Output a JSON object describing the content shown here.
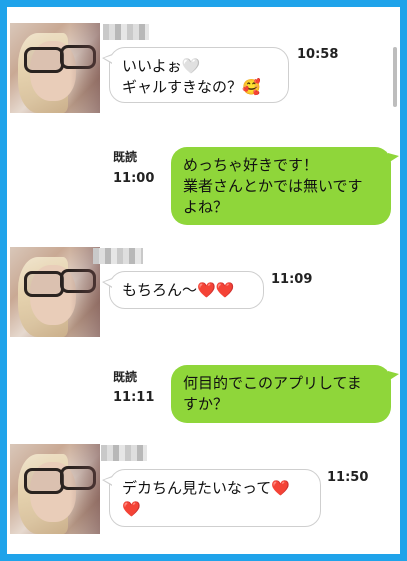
{
  "messages": [
    {
      "side": "in",
      "text": "いいよぉ🤍\nギャルすきなの？🥰",
      "time": "10:58"
    },
    {
      "side": "out",
      "read": "既読",
      "time": "11:00",
      "text": "めっちゃ好きです！\n業者さんとかでは無いです\nよね？"
    },
    {
      "side": "in",
      "text": "もちろん〜❤️❤️",
      "time": "11:09"
    },
    {
      "side": "out",
      "read": "既読",
      "time": "11:11",
      "text": "何目的でこのアプリしてま\nすか？"
    },
    {
      "side": "in",
      "text": "デカちん見たいなって❤️\n❤️",
      "time": "11:50"
    }
  ],
  "colors": {
    "frame": "#1fa3ea",
    "outgoing_bubble": "#8fd63a",
    "incoming_bubble": "#ffffff"
  }
}
